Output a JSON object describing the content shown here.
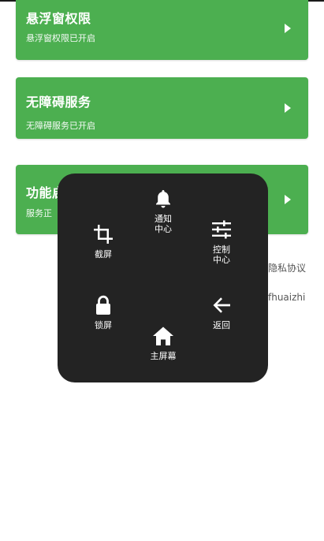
{
  "cards": [
    {
      "title": "悬浮窗权限",
      "subtitle": "悬浮窗权限已开启"
    },
    {
      "title": "无障碍服务",
      "subtitle": "无障碍服务已开启"
    },
    {
      "title": "功能启",
      "subtitle": "服务正"
    }
  ],
  "links": {
    "privacy": "隐私协议",
    "fhuaizhi": "fhuaizhi"
  },
  "float_menu": {
    "notify": "通知\n中心",
    "screenshot": "截屏",
    "control": "控制\n中心",
    "lock": "锁屏",
    "back": "返回",
    "home": "主屏幕"
  },
  "colors": {
    "card_green": "#4caf50",
    "panel_dark": "#232323"
  }
}
